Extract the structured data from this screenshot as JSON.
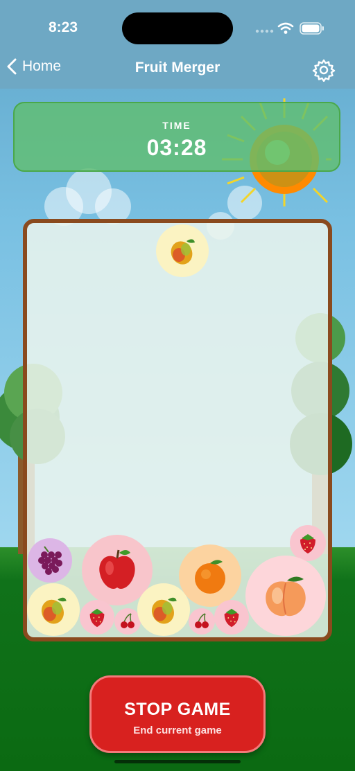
{
  "status_bar": {
    "time": "8:23"
  },
  "nav": {
    "back_label": "Home",
    "title": "Fruit Merger"
  },
  "timer": {
    "label": "TIME",
    "value": "03:28"
  },
  "game": {
    "dropper_fruit": "mango",
    "fruits": [
      "grapes",
      "apple",
      "orange",
      "strawberry",
      "mango",
      "strawberry",
      "cherry",
      "mango",
      "cherry",
      "strawberry",
      "peach"
    ]
  },
  "stop_button": {
    "label": "STOP GAME",
    "sublabel": "End current game"
  },
  "colors": {
    "board_border": "#8a4a1e",
    "stop_button": "#d8211f",
    "timer_panel": "#60be6e"
  }
}
